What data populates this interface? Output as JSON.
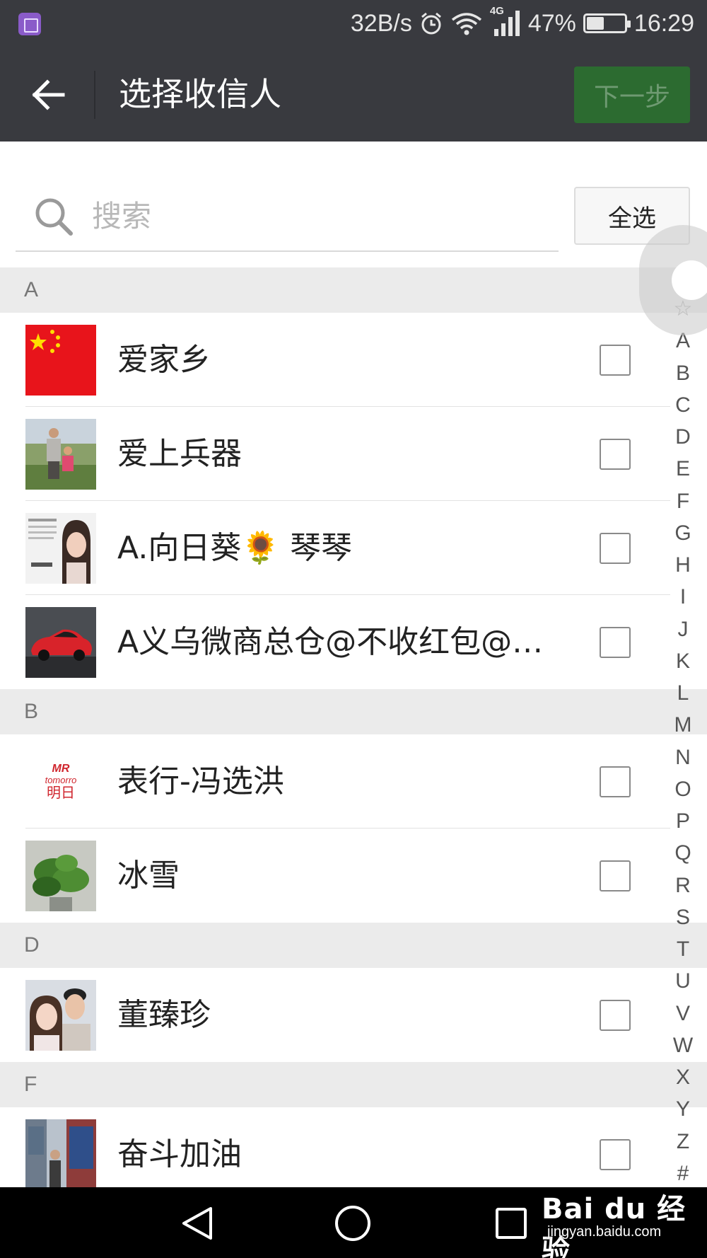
{
  "status_bar": {
    "net_speed": "32B/s",
    "network_type": "4G",
    "battery_percent": "47%",
    "battery_level": 0.47,
    "time": "16:29"
  },
  "header": {
    "title": "选择收信人",
    "next_label": "下一步"
  },
  "search": {
    "placeholder": "搜索",
    "select_all_label": "全选"
  },
  "sections": [
    {
      "letter": "A",
      "contacts": [
        {
          "name": "爱家乡",
          "checked": false
        },
        {
          "name": "爱上兵器",
          "checked": false
        },
        {
          "name": "A.向日葵🌻 琴琴",
          "checked": false
        },
        {
          "name": "A义乌微商总仓@不收红包@诚...",
          "checked": false
        }
      ]
    },
    {
      "letter": "B",
      "contacts": [
        {
          "name": "表行-冯选洪",
          "checked": false
        },
        {
          "name": "冰雪",
          "checked": false
        }
      ]
    },
    {
      "letter": "D",
      "contacts": [
        {
          "name": "董臻珍",
          "checked": false
        }
      ]
    },
    {
      "letter": "F",
      "contacts": [
        {
          "name": "奋斗加油",
          "checked": false
        }
      ]
    }
  ],
  "avatar_texts": {
    "mr_line1": "MR",
    "mr_line2": "tomorro",
    "mr_line3": "明日"
  },
  "index_letters": [
    "☆",
    "A",
    "B",
    "C",
    "D",
    "E",
    "F",
    "G",
    "H",
    "I",
    "J",
    "K",
    "L",
    "M",
    "N",
    "O",
    "P",
    "Q",
    "R",
    "S",
    "T",
    "U",
    "V",
    "W",
    "X",
    "Y",
    "Z",
    "#"
  ],
  "watermark": {
    "brand": "Bai du 经验",
    "url": "jingyan.baidu.com"
  },
  "colors": {
    "bar_bg": "#393a3f",
    "next_button_bg": "#2c6b30",
    "section_bg": "#ebebeb"
  }
}
